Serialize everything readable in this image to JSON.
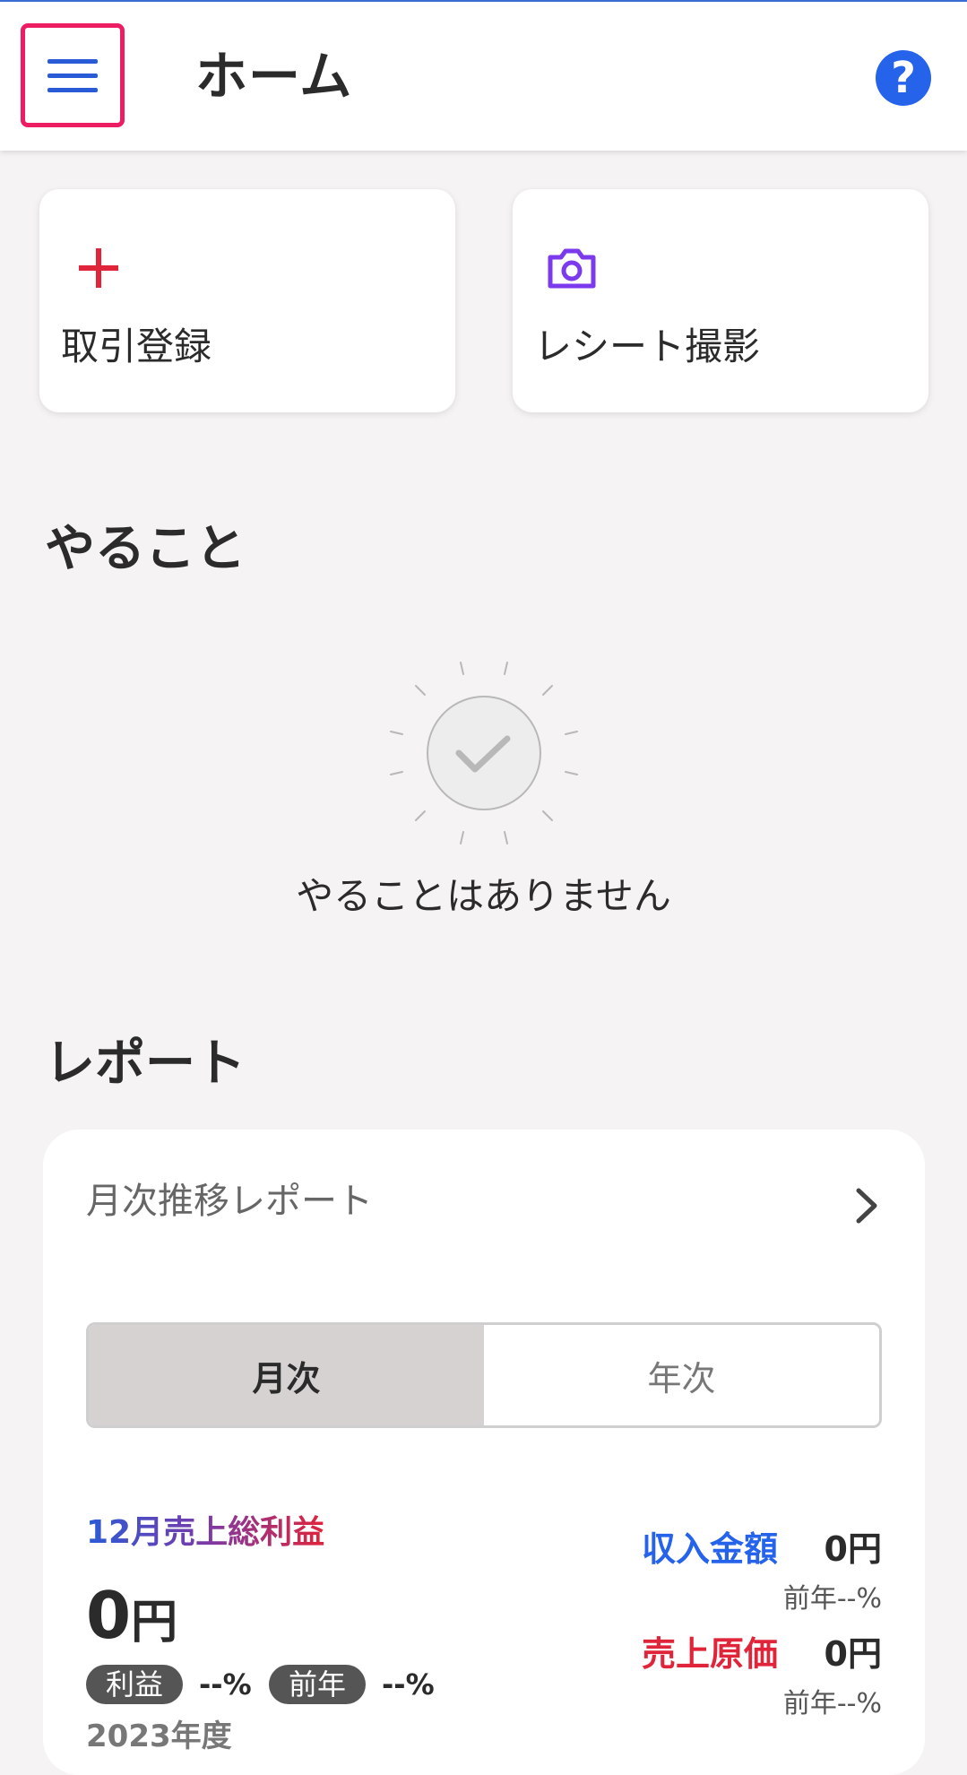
{
  "header": {
    "title": "ホーム",
    "help_glyph": "?"
  },
  "actions": [
    {
      "label": "取引登録",
      "icon": "plus-icon",
      "color": "#e0243a"
    },
    {
      "label": "レシート撮影",
      "icon": "camera-icon",
      "color": "#7c3aed"
    }
  ],
  "todo": {
    "title": "やること",
    "empty_text": "やることはありません"
  },
  "report": {
    "section_title": "レポート",
    "card_title": "月次推移レポート",
    "tabs": [
      {
        "label": "月次",
        "active": true
      },
      {
        "label": "年次",
        "active": false
      }
    ],
    "gross_profit": {
      "label": "12月売上総利益",
      "value": "0",
      "unit": "円",
      "profit_pill": "利益",
      "profit_pct": "--%",
      "prev_pill": "前年",
      "prev_pct": "--%",
      "year_label": "2023年度"
    },
    "metrics": [
      {
        "label": "収入金額",
        "value": "0円",
        "sub": "前年--%",
        "color": "#2563eb"
      },
      {
        "label": "売上原価",
        "value": "0円",
        "sub": "前年--%",
        "color": "#e0243a"
      }
    ]
  }
}
